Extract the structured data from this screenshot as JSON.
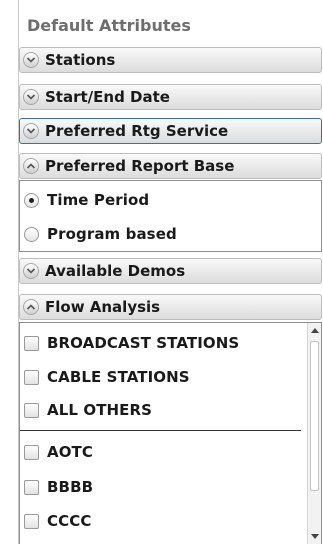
{
  "panel": {
    "title": "Default Attributes",
    "sections": [
      {
        "label": "Stations",
        "state": "collapsed",
        "icon": "chevron-down-icon"
      },
      {
        "label": "Start/End Date",
        "state": "collapsed",
        "icon": "chevron-down-icon"
      },
      {
        "label": "Preferred Rtg Service",
        "state": "collapsed",
        "icon": "chevron-down-icon",
        "focused": true
      },
      {
        "label": "Preferred Report Base",
        "state": "expanded",
        "icon": "chevron-up-icon"
      },
      {
        "label": "Available Demos",
        "state": "collapsed",
        "icon": "chevron-down-icon"
      },
      {
        "label": "Flow Analysis",
        "state": "expanded",
        "icon": "chevron-up-icon"
      }
    ],
    "report_base": {
      "options": [
        {
          "label": "Time Period",
          "selected": true
        },
        {
          "label": "Program based",
          "selected": false
        }
      ]
    },
    "flow_analysis": {
      "groups": [
        {
          "label": "BROADCAST STATIONS",
          "checked": false
        },
        {
          "label": "CABLE STATIONS",
          "checked": false
        },
        {
          "label": "ALL OTHERS",
          "checked": false
        }
      ],
      "items": [
        {
          "label": "AOTC",
          "checked": false
        },
        {
          "label": "BBBB",
          "checked": false
        },
        {
          "label": "CCCC",
          "checked": false
        }
      ]
    }
  },
  "colors": {
    "section_focus_border": "#3f6ea3",
    "title_text": "#6e6e6e"
  }
}
